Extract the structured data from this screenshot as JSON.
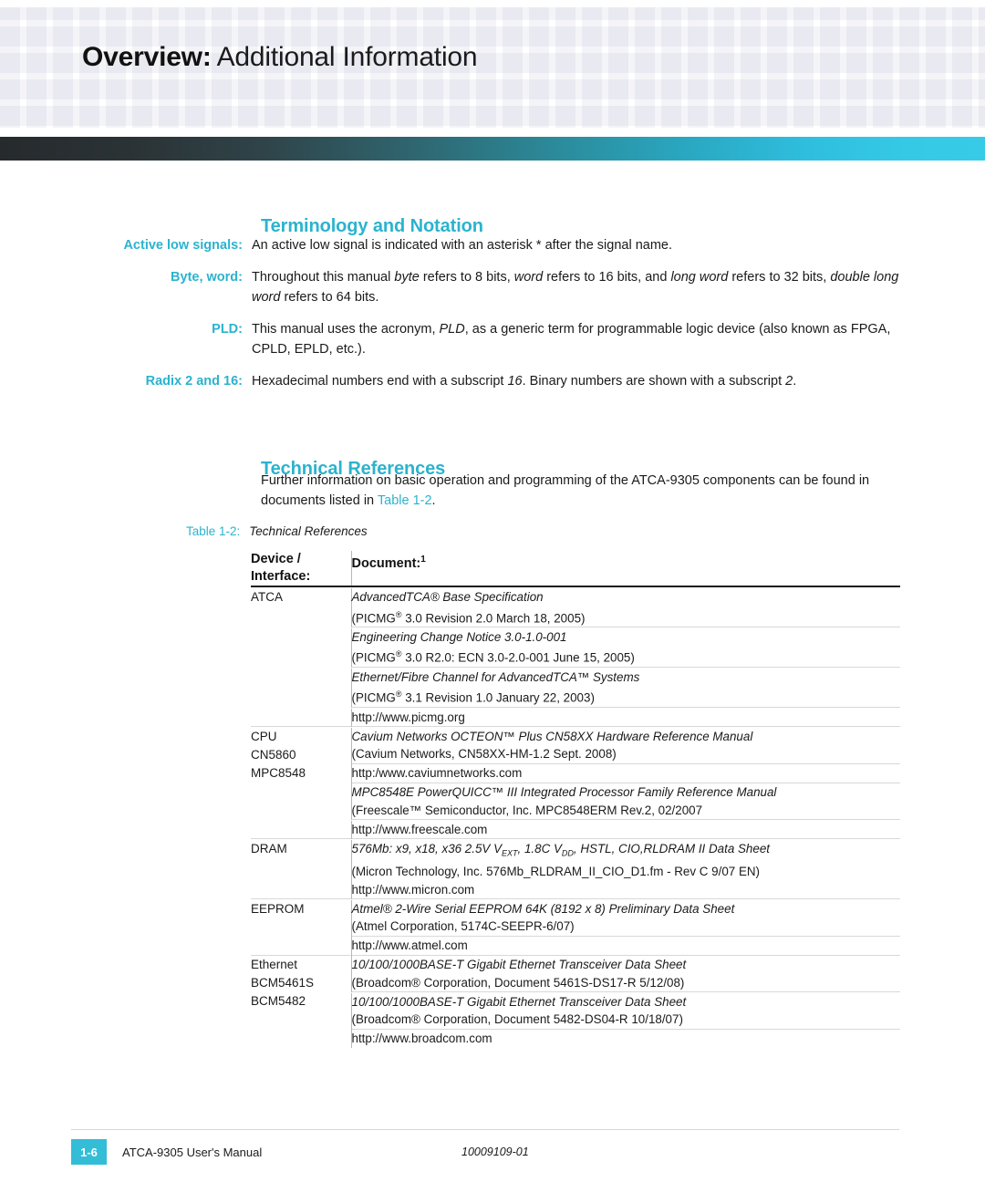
{
  "header": {
    "title_bold": "Overview:",
    "title_light": "Additional Information"
  },
  "sections": {
    "terminology_heading": "Terminology and Notation",
    "technical_heading": "Technical References"
  },
  "terminology": [
    {
      "term": "Active low signals:",
      "desc": "An active low signal is indicated with an asterisk * after the signal name."
    },
    {
      "term": "Byte, word:",
      "desc": "Throughout this manual byte refers to 8 bits, word refers to 16 bits, and long word refers to 32 bits, double long word refers to 64 bits."
    },
    {
      "term": "PLD:",
      "desc": "This manual uses the acronym, PLD, as a generic term for programmable logic device (also known as FPGA, CPLD, EPLD, etc.)."
    },
    {
      "term": "Radix 2 and 16:",
      "desc": "Hexadecimal numbers end with a subscript 16. Binary numbers are shown with a subscript 2."
    }
  ],
  "technical_references": {
    "paragraph_part1": "Further information on basic operation and programming of the ATCA-9305 components can be found in documents listed in ",
    "paragraph_link": "Table 1-2",
    "paragraph_part2": ".",
    "table_caption_label": "Table 1-2:",
    "table_caption_text": "Technical References",
    "columns": {
      "device": "Device / Interface:",
      "device_line1": "Device /",
      "device_line2": "Interface:",
      "document": "Document:",
      "document_footnote": "1"
    },
    "rows": [
      {
        "device_lines": [
          "ATCA"
        ],
        "entries": [
          {
            "title": "AdvancedTCA® Base Specification",
            "detail_pre": "(PICMG",
            "detail_sup": "®",
            "detail_post": " 3.0 Revision 2.0 March 18, 2005)"
          },
          {
            "title": "Engineering Change Notice 3.0-1.0-001",
            "detail_pre": "(PICMG",
            "detail_sup": "®",
            "detail_post": " 3.0 R2.0: ECN 3.0-2.0-001 June 15, 2005)"
          },
          {
            "title": "Ethernet/Fibre Channel for AdvancedTCA™ Systems",
            "detail_pre": "(PICMG",
            "detail_sup": "®",
            "detail_post": " 3.1 Revision 1.0 January 22, 2003)"
          },
          {
            "url": "http://www.picmg.org"
          }
        ]
      },
      {
        "device_lines": [
          "CPU",
          "CN5860",
          "MPC8548"
        ],
        "entries": [
          {
            "title": "Cavium Networks OCTEON™ Plus CN58XX Hardware Reference Manual",
            "detail_post": "(Cavium Networks, CN58XX-HM-1.2 Sept. 2008)"
          },
          {
            "url": "http:/www.caviumnetworks.com"
          },
          {
            "title": "MPC8548E PowerQUICC™ III Integrated Processor Family Reference Manual",
            "detail_post": "(Freescale™ Semiconductor, Inc. MPC8548ERM Rev.2, 02/2007"
          },
          {
            "url": "http://www.freescale.com"
          }
        ]
      },
      {
        "device_lines": [
          "DRAM"
        ],
        "entries": [
          {
            "title_seg1": "576Mb: x9, x18, x36 2.5V V",
            "title_sub1": "EXT",
            "title_seg2": ", 1.8C V",
            "title_sub2": "DD",
            "title_seg3": ", HSTL, CIO,RLDRAM II Data Sheet",
            "detail_post": "(Micron Technology, Inc. 576Mb_RLDRAM_II_CIO_D1.fm - Rev C 9/07 EN)",
            "url_inline": "http://www.micron.com"
          }
        ]
      },
      {
        "device_lines": [
          "EEPROM"
        ],
        "entries": [
          {
            "title": "Atmel® 2-Wire Serial EEPROM 64K (8192 x 8) Preliminary Data Sheet",
            "detail_post": "(Atmel Corporation, 5174C-SEEPR-6/07)"
          },
          {
            "url": "http://www.atmel.com"
          }
        ]
      },
      {
        "device_lines": [
          "Ethernet",
          "BCM5461S",
          "BCM5482"
        ],
        "entries": [
          {
            "title": "10/100/1000BASE-T Gigabit Ethernet Transceiver Data Sheet",
            "detail_post": "(Broadcom® Corporation, Document 5461S-DS17-R 5/12/08)"
          },
          {
            "title": "10/100/1000BASE-T Gigabit Ethernet Transceiver Data Sheet",
            "detail_post": "(Broadcom® Corporation, Document 5482-DS04-R 10/18/07)"
          },
          {
            "url": "http://www.broadcom.com"
          }
        ]
      }
    ]
  },
  "footer": {
    "page_number": "1-6",
    "manual_title": "ATCA-9305 User's Manual",
    "document_number": "10009109-01"
  },
  "colors": {
    "accent_teal": "#2bb3ce",
    "footer_box": "#33bdd6",
    "gradient_start": "#262a2d",
    "gradient_end": "#37cbe8"
  }
}
